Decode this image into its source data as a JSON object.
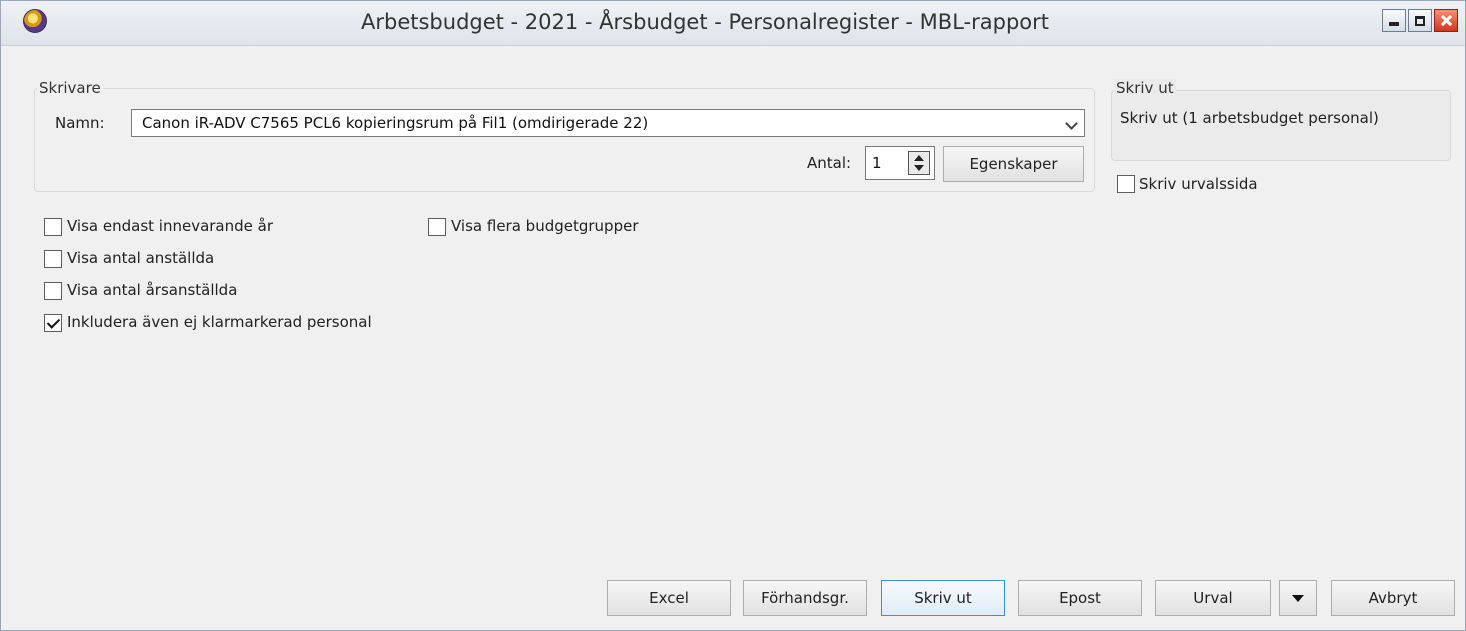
{
  "window": {
    "title": "Arbetsbudget - 2021 - Årsbudget - Personalregister - MBL-rapport"
  },
  "printer_group": {
    "legend": "Skrivare",
    "name_label": "Namn:",
    "printer_name": "Canon iR-ADV C7565 PCL6 kopieringsrum på Fil1 (omdirigerade 22)",
    "copies_label": "Antal:",
    "copies_value": "1",
    "properties_button": "Egenskaper"
  },
  "printout_group": {
    "legend": "Skriv ut",
    "summary": "Skriv ut (1 arbetsbudget personal)"
  },
  "options": {
    "print_selection_page": {
      "label": "Skriv urvalssida",
      "checked": false
    },
    "current_year_only": {
      "label": "Visa endast innevarande år",
      "checked": false
    },
    "show_employee_count": {
      "label": "Visa antal anställda",
      "checked": false
    },
    "show_annual_employees": {
      "label": "Visa antal årsanställda",
      "checked": false
    },
    "include_unmarked_staff": {
      "label": "Inkludera även ej klarmarkerad personal",
      "checked": true
    },
    "show_multiple_budget_groups": {
      "label": "Visa flera budgetgrupper",
      "checked": false
    }
  },
  "buttons": {
    "excel": "Excel",
    "preview": "Förhandsgr.",
    "print": "Skriv ut",
    "email": "Epost",
    "selection": "Urval",
    "cancel": "Avbryt"
  },
  "icons": {
    "app": "app-logo-icon",
    "minimize": "minimize-icon",
    "maximize": "maximize-icon",
    "close": "close-icon",
    "dropdown": "chevron-down-icon",
    "spinner": "spinner-arrows-icon"
  },
  "colors": {
    "close_button": "#d0361c",
    "default_button_border": "#3c8ee0",
    "window_background": "#f0f0f0"
  }
}
